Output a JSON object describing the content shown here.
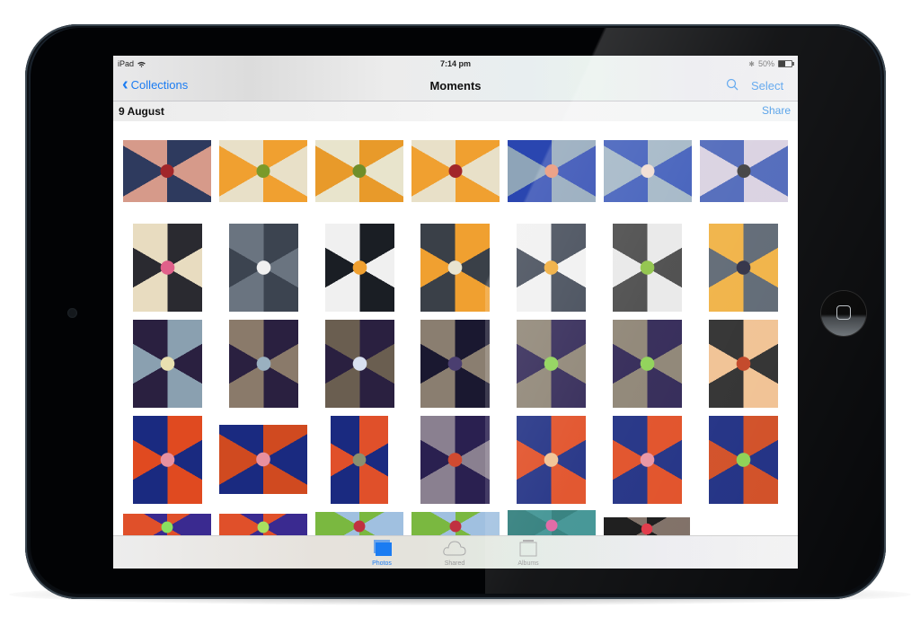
{
  "status_bar": {
    "device": "iPad",
    "time": "7:14 pm",
    "battery_percent_label": "50%",
    "battery_level": 0.5
  },
  "nav_bar": {
    "back_label": "Collections",
    "title": "Moments",
    "select_label": "Select"
  },
  "section": {
    "date": "9 August",
    "share_label": "Share"
  },
  "photos": [
    {
      "name": "kaleidoscope-1",
      "colors": [
        "#2e3a5e",
        "#d69a8a",
        "#a1262a"
      ]
    },
    {
      "name": "kaleidoscope-2",
      "colors": [
        "#f0a030",
        "#e8e0c8",
        "#7a9a2a"
      ]
    },
    {
      "name": "kaleidoscope-3",
      "colors": [
        "#e89a2a",
        "#e8e4cc",
        "#6f8e2a"
      ]
    },
    {
      "name": "kaleidoscope-4",
      "colors": [
        "#f0a030",
        "#e8e0c8",
        "#a1262a"
      ]
    },
    {
      "name": "kaleidoscope-5",
      "colors": [
        "#8ea4b8",
        "#2a46b0",
        "#e89070"
      ]
    },
    {
      "name": "kaleidoscope-6",
      "colors": [
        "#a0b4c4",
        "#3a58b8",
        "#f0dcd0"
      ]
    },
    {
      "name": "kaleidoscope-7",
      "colors": [
        "#d8d0e0",
        "#4a64b8",
        "#3a3a3a"
      ]
    },
    {
      "name": "kaleidoscope-8",
      "colors": [
        "#2a2a30",
        "#e8dcc0",
        "#e0608a"
      ]
    },
    {
      "name": "kaleidoscope-9",
      "colors": [
        "#3c4450",
        "#6a7480",
        "#f0f0f0"
      ]
    },
    {
      "name": "kaleidoscope-10",
      "colors": [
        "#1a1e24",
        "#f0f0f0",
        "#f0a030"
      ]
    },
    {
      "name": "kaleidoscope-11",
      "colors": [
        "#f0a030",
        "#3a4048",
        "#e8e4d0"
      ]
    },
    {
      "name": "kaleidoscope-12",
      "colors": [
        "#3a4250",
        "#f0f0f0",
        "#f0a830"
      ]
    },
    {
      "name": "kaleidoscope-13",
      "colors": [
        "#e8e8e8",
        "#444",
        "#8ac040"
      ]
    },
    {
      "name": "kaleidoscope-14",
      "colors": [
        "#5a6470",
        "#f0b040",
        "#2a2a40"
      ]
    },
    {
      "name": "kaleidoscope-15",
      "colors": [
        "#8aa0b0",
        "#2a2040",
        "#e8e0b0"
      ]
    },
    {
      "name": "kaleidoscope-16",
      "colors": [
        "#2a2040",
        "#8a7a6a",
        "#9ab0c0"
      ]
    },
    {
      "name": "kaleidoscope-17",
      "colors": [
        "#2a2040",
        "#6a5e50",
        "#d8e0f0"
      ]
    },
    {
      "name": "kaleidoscope-18",
      "colors": [
        "#1a1830",
        "#8a7e70",
        "#4a3e70"
      ]
    },
    {
      "name": "kaleidoscope-19",
      "colors": [
        "#2a2050",
        "#8a8070",
        "#8ad050"
      ]
    },
    {
      "name": "kaleidoscope-20",
      "colors": [
        "#2a2050",
        "#8a8070",
        "#8ad050"
      ]
    },
    {
      "name": "kaleidoscope-21",
      "colors": [
        "#f0c090",
        "#2a2a2a",
        "#c04020"
      ]
    },
    {
      "name": "kaleidoscope-22",
      "colors": [
        "#e04a20",
        "#1a2a80",
        "#e890a0"
      ]
    },
    {
      "name": "kaleidoscope-23",
      "colors": [
        "#d04a20",
        "#1a2a80",
        "#e890a0"
      ]
    },
    {
      "name": "kaleidoscope-24",
      "colors": [
        "#e0502a",
        "#1a2a80",
        "#8a9070"
      ]
    },
    {
      "name": "kaleidoscope-25",
      "colors": [
        "#2a2050",
        "#8a8090",
        "#d04a30"
      ]
    },
    {
      "name": "kaleidoscope-26",
      "colors": [
        "#e04a20",
        "#1a2a80",
        "#f0c090"
      ]
    },
    {
      "name": "kaleidoscope-27",
      "colors": [
        "#e04a20",
        "#1a2a80",
        "#e890a0"
      ]
    },
    {
      "name": "kaleidoscope-28",
      "colors": [
        "#d04a20",
        "#1a2a80",
        "#8ad050"
      ]
    },
    {
      "name": "kaleidoscope-29",
      "colors": [
        "#e0502a",
        "#3a2a90",
        "#8ae060"
      ]
    },
    {
      "name": "kaleidoscope-30",
      "colors": [
        "#e0502a",
        "#3a2a90",
        "#a8e060"
      ]
    },
    {
      "name": "photo-31",
      "colors": [
        "#7ab840",
        "#a0c0e0",
        "#c03040"
      ]
    },
    {
      "name": "photo-32",
      "colors": [
        "#7ab840",
        "#a0c0e0",
        "#c03040"
      ]
    },
    {
      "name": "photo-33",
      "colors": [
        "#2a7a78",
        "#3a9090",
        "#e060a0"
      ]
    },
    {
      "name": "photo-34",
      "colors": [
        "#101010",
        "#7a6a60",
        "#e03040"
      ]
    }
  ],
  "tab_bar": {
    "tabs": [
      {
        "label": "Photos",
        "icon": "photos-icon",
        "active": true
      },
      {
        "label": "Shared",
        "icon": "cloud-icon",
        "active": false
      },
      {
        "label": "Albums",
        "icon": "albums-icon",
        "active": false
      }
    ]
  }
}
